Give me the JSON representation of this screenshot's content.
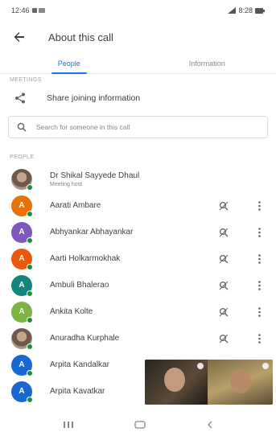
{
  "status_bar": {
    "time": "12:46",
    "right_text": "8:28"
  },
  "app_bar": {
    "title": "About this call"
  },
  "tabs": [
    {
      "label": "People",
      "active": true
    },
    {
      "label": "Information",
      "active": false
    }
  ],
  "sections": {
    "top_label": "MEETINGS",
    "people_label": "PEOPLE"
  },
  "share": {
    "label": "Share joining information"
  },
  "search": {
    "placeholder": "Search for someone in this call"
  },
  "participants": [
    {
      "name": "Dr Shikal Sayyede Dhaul",
      "sub": "Meeting host",
      "initial": "",
      "color": "#8d7b6e",
      "photo": true,
      "actions": false
    },
    {
      "name": "Aarati Ambare",
      "initial": "A",
      "color": "#e8710a",
      "photo": false,
      "actions": true
    },
    {
      "name": "Abhyankar Abhayankar",
      "initial": "A",
      "color": "#7e57c2",
      "photo": false,
      "actions": true
    },
    {
      "name": "Aarti Holkarmokhak",
      "initial": "A",
      "color": "#e8590c",
      "photo": false,
      "actions": true
    },
    {
      "name": "Ambuli Bhalerao",
      "initial": "A",
      "color": "#12867d",
      "photo": false,
      "actions": true
    },
    {
      "name": "Ankita Kolte",
      "initial": "A",
      "color": "#7cb342",
      "photo": false,
      "actions": true
    },
    {
      "name": "Anuradha Kurphale",
      "initial": "",
      "color": "#a38b7a",
      "photo": true,
      "actions": true
    },
    {
      "name": "Arpita Kandalkar",
      "initial": "A",
      "color": "#1967d2",
      "photo": false,
      "actions": false
    },
    {
      "name": "Arpita Kavatkar",
      "initial": "A",
      "color": "#1967d2",
      "photo": false,
      "actions": false
    }
  ],
  "icons": {
    "back": "arrow-left-icon",
    "share": "share-icon",
    "search": "search-icon",
    "mute": "mic-mute-icon",
    "more": "more-vertical-icon"
  },
  "colors": {
    "accent": "#1a73e8",
    "online": "#1e8e3e"
  }
}
